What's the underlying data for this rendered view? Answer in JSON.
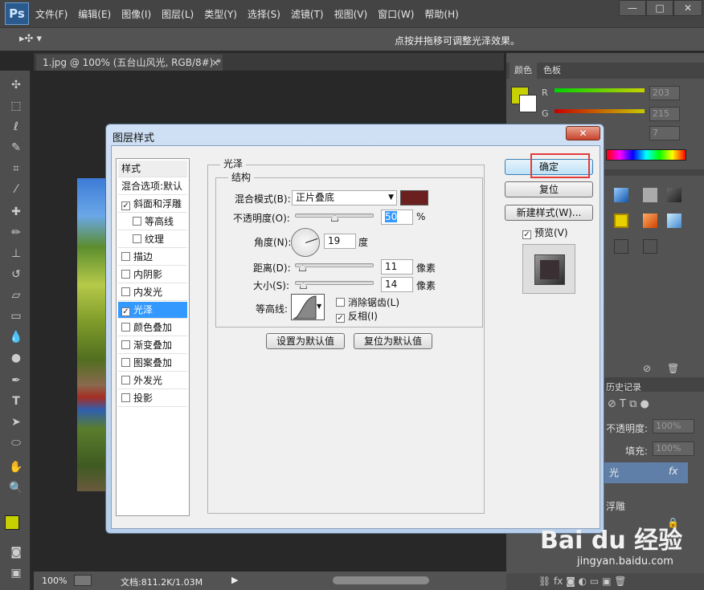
{
  "app": {
    "logo": "Ps",
    "menus": [
      "文件(F)",
      "编辑(E)",
      "图像(I)",
      "图层(L)",
      "类型(Y)",
      "选择(S)",
      "滤镜(T)",
      "视图(V)",
      "窗口(W)",
      "帮助(H)"
    ]
  },
  "options": {
    "hint": "点按并拖移可调整光泽效果。"
  },
  "document": {
    "tab": "1.jpg @ 100% (五台山风光, RGB/8#) *",
    "zoom": "100%",
    "docsize": "文档:811.2K/1.03M"
  },
  "color_panel": {
    "tabs": [
      "颜色",
      "色板"
    ],
    "r_label": "R",
    "g_label": "G",
    "r_value": "203",
    "g_value": "215",
    "b_value": "7",
    "fg": "#c8d100",
    "bg": "#ffffff"
  },
  "layers_panel": {
    "history_tab": "历史记录",
    "opacity_label": "不透明度:",
    "opacity_value": "100%",
    "fill_label": "填充:",
    "fill_value": "100%",
    "layer_name_partial": "光",
    "layer_effect_partial": "浮雕",
    "fx": "fx"
  },
  "dialog": {
    "title": "图层样式",
    "close": "✕",
    "styles_header": "样式",
    "blend_options": "混合选项:默认",
    "items": [
      {
        "label": "斜面和浮雕",
        "checked": true,
        "indent": false,
        "selected": false
      },
      {
        "label": "等高线",
        "checked": false,
        "indent": true,
        "selected": false
      },
      {
        "label": "纹理",
        "checked": false,
        "indent": true,
        "selected": false
      },
      {
        "label": "描边",
        "checked": false,
        "indent": false,
        "selected": false
      },
      {
        "label": "内阴影",
        "checked": false,
        "indent": false,
        "selected": false
      },
      {
        "label": "内发光",
        "checked": false,
        "indent": false,
        "selected": false
      },
      {
        "label": "光泽",
        "checked": true,
        "indent": false,
        "selected": true
      },
      {
        "label": "颜色叠加",
        "checked": false,
        "indent": false,
        "selected": false
      },
      {
        "label": "渐变叠加",
        "checked": false,
        "indent": false,
        "selected": false
      },
      {
        "label": "图案叠加",
        "checked": false,
        "indent": false,
        "selected": false
      },
      {
        "label": "外发光",
        "checked": false,
        "indent": false,
        "selected": false
      },
      {
        "label": "投影",
        "checked": false,
        "indent": false,
        "selected": false
      }
    ],
    "section_title": "光泽",
    "group_title": "结构",
    "blend_mode_label": "混合模式(B):",
    "blend_mode_value": "正片叠底",
    "blend_color": "#6b1f1f",
    "opacity_label": "不透明度(O):",
    "opacity_value": "50",
    "opacity_unit": "%",
    "opacity_level": 0.5,
    "angle_label": "角度(N):",
    "angle_value": "19",
    "angle_unit": "度",
    "distance_label": "距离(D):",
    "distance_value": "11",
    "distance_unit": "像素",
    "size_label": "大小(S):",
    "size_value": "14",
    "size_unit": "像素",
    "contour_label": "等高线:",
    "antialias_label": "消除锯齿(L)",
    "antialias_checked": false,
    "invert_label": "反相(I)",
    "invert_checked": true,
    "make_default": "设置为默认值",
    "reset_default": "复位为默认值",
    "ok": "确定",
    "reset": "复位",
    "new_style": "新建样式(W)...",
    "preview_label": "预览(V)",
    "preview_checked": true
  },
  "watermark": {
    "brand": "Bai du 经验",
    "url": "jingyan.baidu.com"
  }
}
